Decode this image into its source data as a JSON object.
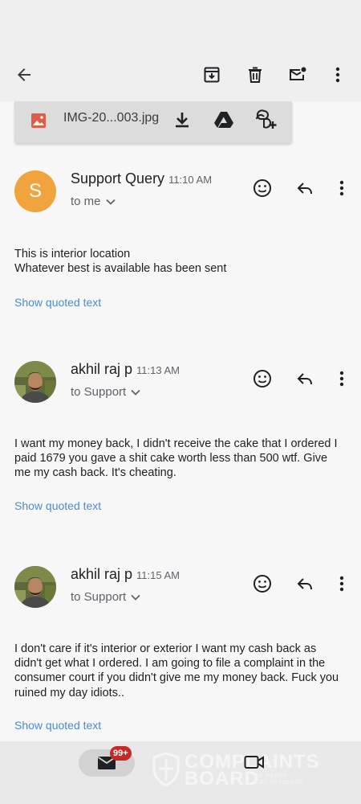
{
  "attachment": {
    "filename": "IMG-20...003.jpg"
  },
  "messages": [
    {
      "sender": "Support Query",
      "time": "11:10 AM",
      "avatar_letter": "S",
      "recipient": "to me",
      "body": [
        "This is interior location",
        "Whatever best is available has been sent"
      ],
      "quoted_label": "Show quoted text"
    },
    {
      "sender": "akhil raj p",
      "time": "11:13 AM",
      "recipient": "to Support",
      "body": [
        "I want my money back, I didn't receive the cake that I ordered I",
        "paid 1679 you gave a shit cake worth less than 500 wtf. Give",
        "me my cash back. It's cheating."
      ],
      "quoted_label": "Show quoted text"
    },
    {
      "sender": "akhil raj p",
      "time": "11:15 AM",
      "recipient": "to Support",
      "body": [
        "I don't care if it's interior or exterior I want my cash back as",
        "didn't get what I ordered. I am going to file a complaint in the",
        "consumer court if you didn't give me my money back. Fuck you",
        "ruined my day idiots.."
      ],
      "quoted_label": "Show quoted text"
    }
  ],
  "bottom_nav": {
    "mail_badge": "99+"
  },
  "watermark": {
    "line1": "COMPLAINTS",
    "line2": "BOARD",
    "sub1": "BE HEARD",
    "sub2": "GET RESOLVED"
  },
  "icons": {
    "appbar": [
      "back-arrow-icon",
      "archive-icon",
      "delete-icon",
      "mark-unread-icon",
      "more-vert-icon"
    ],
    "attachment": [
      "image-file-icon",
      "download-icon",
      "drive-icon",
      "add-to-photos-icon"
    ],
    "message": [
      "emoji-reaction-icon",
      "reply-icon",
      "more-vert-icon",
      "chevron-down-icon"
    ],
    "bottom": [
      "mail-icon",
      "video-camera-icon"
    ]
  },
  "colors": {
    "avatar_s": "#f1a33e",
    "link": "#4a8bd6",
    "badge": "#c62828"
  }
}
